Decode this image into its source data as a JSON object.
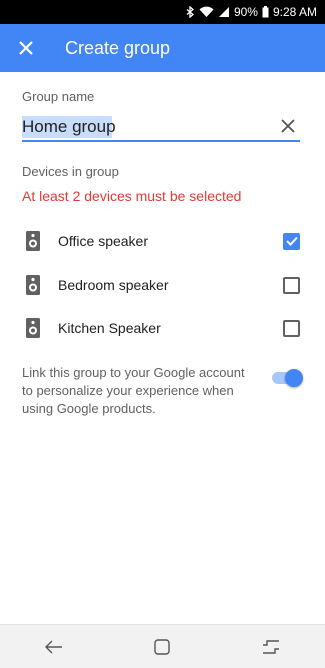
{
  "status_bar": {
    "battery": "90%",
    "time": "9:28 AM",
    "icons": [
      "bluetooth-icon",
      "wifi-icon",
      "signal-icon",
      "battery-icon"
    ]
  },
  "app_bar": {
    "title": "Create group",
    "close_icon": "close-icon",
    "color": "#4285f4"
  },
  "form": {
    "group_name_label": "Group name",
    "group_name_value": "Home group",
    "clear_icon": "clear-icon",
    "devices_label": "Devices in group",
    "error": "At least 2 devices must be selected",
    "error_color": "#e53935",
    "devices": [
      {
        "name": "Office speaker",
        "checked": true,
        "icon": "speaker-icon"
      },
      {
        "name": "Bedroom speaker",
        "checked": false,
        "icon": "speaker-icon"
      },
      {
        "name": "Kitchen Speaker",
        "checked": false,
        "icon": "speaker-icon"
      }
    ],
    "link_text": "Link this group to your Google account to personalize your experience when using Google products.",
    "link_toggle_on": true
  },
  "nav_bar": {
    "buttons": [
      "back-icon",
      "home-icon",
      "recents-icon"
    ]
  }
}
